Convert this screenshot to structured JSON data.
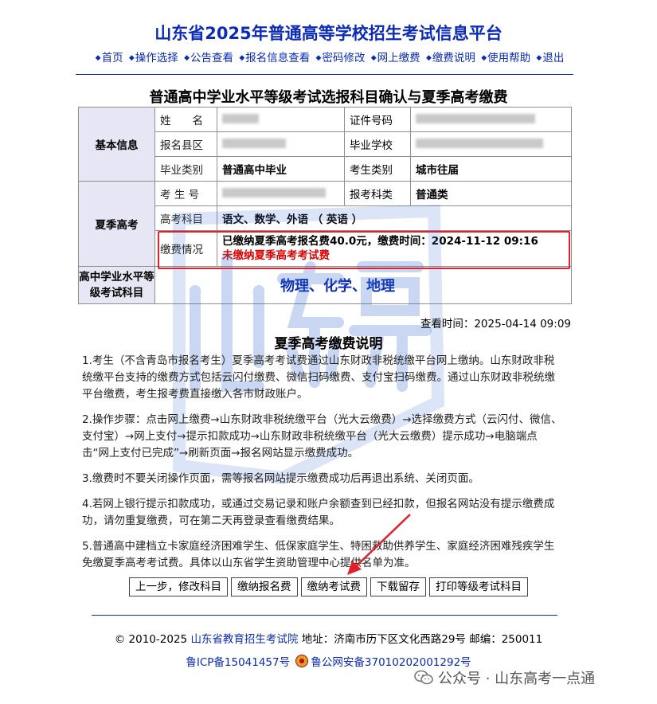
{
  "site_title": "山东省2025年普通高等学校招生考试信息平台",
  "nav": [
    "首页",
    "操作选择",
    "公告查看",
    "报名信息查看",
    "密码修改",
    "网上缴费",
    "缴费说明",
    "使用帮助",
    "退出"
  ],
  "page_title": "普通高中学业水平等级考试选报科目确认与夏季高考缴费",
  "basic": {
    "group": "基本信息",
    "name_label": "姓　　名",
    "id_label": "证件号码",
    "county_label": "报名县区",
    "school_label": "毕业学校",
    "grad_type_label": "毕业类别",
    "grad_type_value": "普通高中毕业",
    "student_type_label": "考生类别",
    "student_type_value": "城市往届"
  },
  "summer": {
    "group": "夏季高考",
    "exam_no_label": "考 生 号",
    "category_label": "报考科类",
    "category_value": "普通类",
    "subjects_label": "高考科目",
    "subjects_value": "语文、数学、外语 （ 英语 ）",
    "payment_label": "缴费情况",
    "payment_paid": "已缴纳夏季高考报名费40.0元，缴费时间：2024-11-12 09:16",
    "payment_unpaid": "未缴纳夏季高考考试费"
  },
  "level_exam": {
    "group": "高中学业水平等级考试科目",
    "subjects": "物理、化学、地理"
  },
  "view_time": "查看时间：2025-04-14 09:09",
  "notes_title": "夏季高考缴费说明",
  "notes": [
    "1.考生（不含青岛市报名考生）夏季高考考试费通过山东财政非税统缴平台网上缴纳。山东财政非税统缴平台支持的缴费方式包括云闪付缴费、微信扫码缴费、支付宝扫码缴费。通过山东财政非税统缴平台缴费，考生报考费直接缴入各市财政账户。",
    "2.操作步骤：点击网上缴费→山东财政非税统缴平台（光大云缴费）→选择缴费方式（云闪付、微信、支付宝）→网上支付→提示扣款成功→山东财政非税统缴平台（光大云缴费）提示成功→电脑端点击“网上支付已完成”→刷新页面→报名网站显示缴费成功。",
    "3.缴费时不要关闭操作页面，需等报名网站提示缴费成功后再退出系统、关闭页面。",
    "4.若网上银行提示扣款成功，或通过交易记录和账户余额查到已经扣款，但报名网站没有提示缴费成功，请勿重复缴费，可在第二天再登录查看缴费结果。",
    "5.普通高中建档立卡家庭经济困难学生、低保家庭学生、特困救助供养学生、家庭经济困难残疾学生免缴夏季高考考试费。具体以山东省学生资助管理中心提供名单为准。"
  ],
  "buttons": {
    "prev": "上一步，修改科目",
    "pay_registration": "缴纳报名费",
    "pay_exam": "缴纳考试费",
    "download": "下载留存",
    "print": "打印等级考试科目"
  },
  "footer": {
    "copyright": "© 2010-2025",
    "org": "山东省教育招生考试院",
    "address": "地址：济南市历下区文化西路29号 邮编：250011",
    "icp": "鲁ICP备15041457号",
    "police": "鲁公网安备37010202001292号"
  },
  "wechat_label": "公众号 · 山东高考一点通",
  "colors": {
    "accent": "#0b2bb8",
    "alert": "#e00000",
    "group_bg": "#e6e6f4"
  }
}
